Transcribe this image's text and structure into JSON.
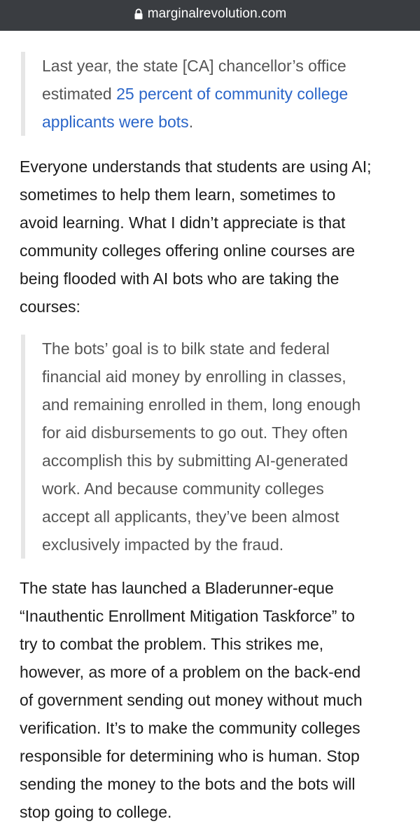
{
  "browser": {
    "url": "marginalrevolution.com",
    "lock_icon": "lock-icon"
  },
  "quote1": {
    "lines": [
      [
        "Last year, the state [CA] chancellor’s office",
        ""
      ],
      [
        "estimated ",
        "25 percent of community college"
      ],
      [
        "",
        "applicants were bots",
        "."
      ]
    ],
    "link_color": "#2b66c9"
  },
  "para1": {
    "lines": [
      "Everyone understands that students are using AI;",
      "sometimes to help them learn, sometimes to",
      "avoid learning. What I didn’t appreciate is that",
      "community colleges offering online courses are",
      "being flooded with AI bots who are taking the",
      "courses:"
    ]
  },
  "quote2": {
    "lines": [
      "The bots’ goal is to bilk state and federal",
      "financial aid money by enrolling in classes,",
      "and remaining enrolled in them, long enough",
      "for aid disbursements to go out. They often",
      "accomplish this by submitting AI-generated",
      "work. And because community colleges",
      "accept all applicants, they’ve been almost",
      "exclusively impacted by the fraud."
    ]
  },
  "para2": {
    "lines": [
      "The state has launched a Bladerunner-eque",
      "“Inauthentic Enrollment Mitigation Taskforce” to",
      "try to combat the problem. This strikes me,",
      "however, as more of a problem on the back-end",
      "of government sending out money without much",
      "verification. It’s to make the community colleges",
      "responsible for determining who is human. Stop",
      "sending the money to the bots and the bots will",
      "stop going to college."
    ]
  }
}
